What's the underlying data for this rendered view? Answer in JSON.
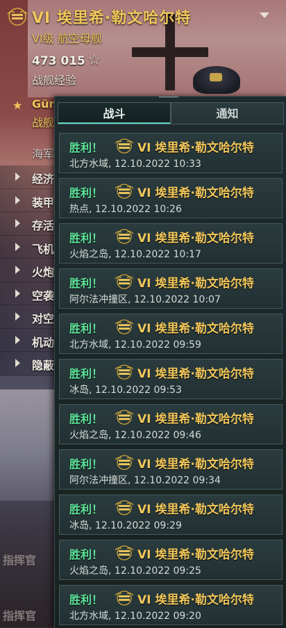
{
  "ship": {
    "title": "VI  埃里希·勒文哈尔特",
    "subtitle": "VI级  航空母舰",
    "xp_value": "473  015",
    "xp_label": "战舰经验"
  },
  "captain": {
    "name": "Gün",
    "sub": "战舰"
  },
  "left_panel": {
    "section_label": "海军",
    "skills": [
      "经济",
      "装甲",
      "存活",
      "飞机",
      "火炮",
      "空袭",
      "对空",
      "机动",
      "隐蔽"
    ],
    "commander_labels": [
      "指挥官",
      "指挥官"
    ]
  },
  "tabs": [
    {
      "label": "战斗",
      "active": true
    },
    {
      "label": "通知",
      "active": false
    }
  ],
  "results": [
    {
      "outcome": "胜利！",
      "ship": "VI  埃里希·勒文哈尔特",
      "map": "北方水域,",
      "datetime": "12.10.2022  10:33"
    },
    {
      "outcome": "胜利！",
      "ship": "VI  埃里希·勒文哈尔特",
      "map": "热点,",
      "datetime": "12.10.2022  10:26"
    },
    {
      "outcome": "胜利！",
      "ship": "VI  埃里希·勒文哈尔特",
      "map": "火焰之岛,",
      "datetime": "12.10.2022  10:17"
    },
    {
      "outcome": "胜利！",
      "ship": "VI  埃里希·勒文哈尔特",
      "map": "阿尔法冲撞区,",
      "datetime": "12.10.2022  10:07"
    },
    {
      "outcome": "胜利！",
      "ship": "VI  埃里希·勒文哈尔特",
      "map": "北方水域,",
      "datetime": "12.10.2022  09:59"
    },
    {
      "outcome": "胜利！",
      "ship": "VI  埃里希·勒文哈尔特",
      "map": "冰岛,",
      "datetime": "12.10.2022  09:53"
    },
    {
      "outcome": "胜利！",
      "ship": "VI  埃里希·勒文哈尔特",
      "map": "火焰之岛,",
      "datetime": "12.10.2022  09:46"
    },
    {
      "outcome": "胜利！",
      "ship": "VI  埃里希·勒文哈尔特",
      "map": "阿尔法冲撞区,",
      "datetime": "12.10.2022  09:34"
    },
    {
      "outcome": "胜利！",
      "ship": "VI  埃里希·勒文哈尔特",
      "map": "冰岛,",
      "datetime": "12.10.2022  09:29"
    },
    {
      "outcome": "胜利！",
      "ship": "VI  埃里希·勒文哈尔特",
      "map": "火焰之岛,",
      "datetime": "12.10.2022  09:25"
    },
    {
      "outcome": "胜利！",
      "ship": "VI  埃里希·勒文哈尔特",
      "map": "北方水域,",
      "datetime": "12.10.2022  09:20"
    }
  ],
  "icons": {
    "rank": "rank-chevron-icon",
    "star": "star-icon",
    "dropdown": "chevron-down-icon",
    "skill_arrow": "caret-right-icon"
  },
  "colors": {
    "gold": "#f1c75b",
    "victory": "#5ee59a",
    "tab_accent": "#5fd6c4"
  }
}
